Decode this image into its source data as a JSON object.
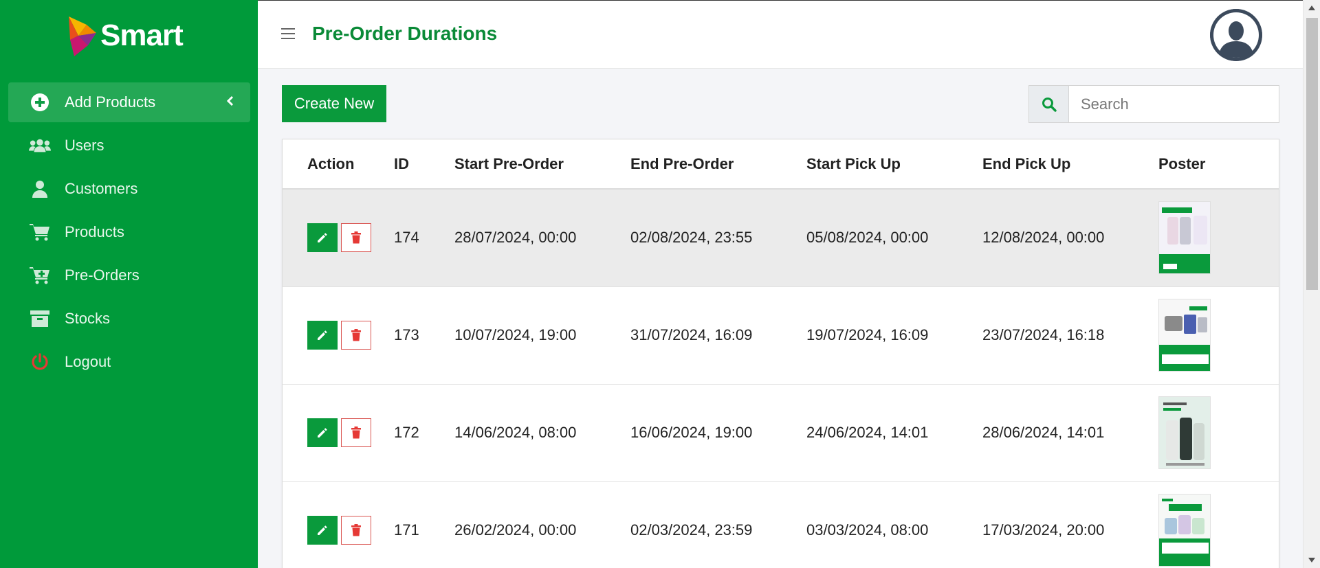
{
  "brand": {
    "name": "Smart"
  },
  "sidebar": {
    "items": [
      {
        "label": "Add Products",
        "icon": "plus-circle-icon",
        "active": true
      },
      {
        "label": "Users",
        "icon": "users-icon"
      },
      {
        "label": "Customers",
        "icon": "user-icon"
      },
      {
        "label": "Products",
        "icon": "cart-icon"
      },
      {
        "label": "Pre-Orders",
        "icon": "cart-plus-icon"
      },
      {
        "label": "Stocks",
        "icon": "archive-icon"
      },
      {
        "label": "Logout",
        "icon": "power-icon"
      }
    ]
  },
  "header": {
    "title": "Pre-Order Durations"
  },
  "toolbar": {
    "create_label": "Create New",
    "search_placeholder": "Search"
  },
  "table": {
    "columns": [
      "Action",
      "ID",
      "Start Pre-Order",
      "End Pre-Order",
      "Start Pick Up",
      "End Pick Up",
      "Poster"
    ],
    "rows": [
      {
        "id": "174",
        "start_preorder": "28/07/2024, 00:00",
        "end_preorder": "02/08/2024, 23:55",
        "start_pickup": "05/08/2024, 00:00",
        "end_pickup": "12/08/2024, 00:00"
      },
      {
        "id": "173",
        "start_preorder": "10/07/2024, 19:00",
        "end_preorder": "31/07/2024, 16:09",
        "start_pickup": "19/07/2024, 16:09",
        "end_pickup": "23/07/2024, 16:18"
      },
      {
        "id": "172",
        "start_preorder": "14/06/2024, 08:00",
        "end_preorder": "16/06/2024, 19:00",
        "start_pickup": "24/06/2024, 14:01",
        "end_pickup": "28/06/2024, 14:01"
      },
      {
        "id": "171",
        "start_preorder": "26/02/2024, 00:00",
        "end_preorder": "02/03/2024, 23:59",
        "start_pickup": "03/03/2024, 08:00",
        "end_pickup": "17/03/2024, 20:00"
      }
    ]
  },
  "colors": {
    "sidebar": "#009a3a",
    "accent": "#0a9a3c",
    "danger": "#d9534f",
    "title": "#0a8a37"
  }
}
